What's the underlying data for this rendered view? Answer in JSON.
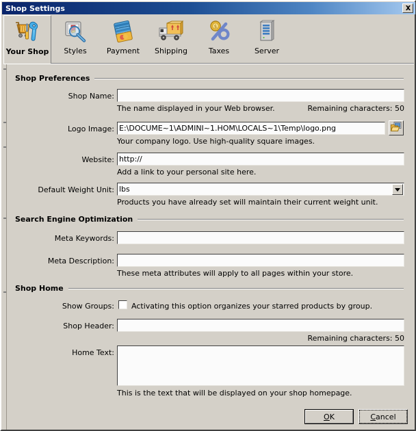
{
  "window": {
    "title": "Shop Settings",
    "close_icon": "close-icon",
    "titlebar_color_left": "#0a246a",
    "titlebar_color_right": "#a6caf0",
    "face_color": "#d4d0c8"
  },
  "tabs": [
    {
      "label": "Your Shop",
      "icon": "shopping-cart-wrench-icon",
      "selected": true
    },
    {
      "label": "Styles",
      "icon": "picture-magnifier-icon",
      "selected": false
    },
    {
      "label": "Payment",
      "icon": "credit-cards-icon",
      "selected": false
    },
    {
      "label": "Shipping",
      "icon": "delivery-truck-icon",
      "selected": false
    },
    {
      "label": "Taxes",
      "icon": "percent-coin-icon",
      "selected": false
    },
    {
      "label": "Server",
      "icon": "server-tower-icon",
      "selected": false
    }
  ],
  "groups": {
    "shop_preferences": "Shop Preferences",
    "seo": "Search Engine Optimization",
    "shop_home": "Shop Home"
  },
  "fields": {
    "shop_name": {
      "label": "Shop Name:",
      "value": "",
      "hint": "The name displayed in your Web browser.",
      "counter": "Remaining characters: 50"
    },
    "logo_image": {
      "label": "Logo Image:",
      "value": "E:\\DOCUME~1\\ADMINI~1.HOM\\LOCALS~1\\Temp\\logo.png",
      "hint": "Your company logo. Use high-quality square images.",
      "browse_icon": "open-folder-image-icon"
    },
    "website": {
      "label": "Website:",
      "value": "http://",
      "hint": "Add a link to your personal site here."
    },
    "default_weight_unit": {
      "label": "Default Weight Unit:",
      "value": "lbs",
      "options": [
        "lbs"
      ],
      "hint": "Products you have already set will maintain their current weight unit.",
      "arrow_icon": "chevron-down-icon"
    },
    "meta_keywords": {
      "label": "Meta Keywords:",
      "value": ""
    },
    "meta_description": {
      "label": "Meta Description:",
      "value": "",
      "hint": "These meta attributes will apply to all pages within your store."
    },
    "show_groups": {
      "label": "Show Groups:",
      "checked": false,
      "caption": "Activating this option organizes your starred products by group."
    },
    "shop_header": {
      "label": "Shop Header:",
      "value": "",
      "counter": "Remaining characters: 50"
    },
    "home_text": {
      "label": "Home Text:",
      "value": "",
      "hint": "This is the text that will be displayed on your shop homepage.",
      "scroll_up_icon": "scroll-up-arrow-icon",
      "scroll_down_icon": "scroll-down-arrow-icon"
    }
  },
  "buttons": {
    "ok": {
      "prefix": "",
      "mnemonic": "O",
      "suffix": "K",
      "default": true
    },
    "cancel": {
      "prefix": "",
      "mnemonic": "C",
      "suffix": "ancel",
      "focused": true
    }
  }
}
